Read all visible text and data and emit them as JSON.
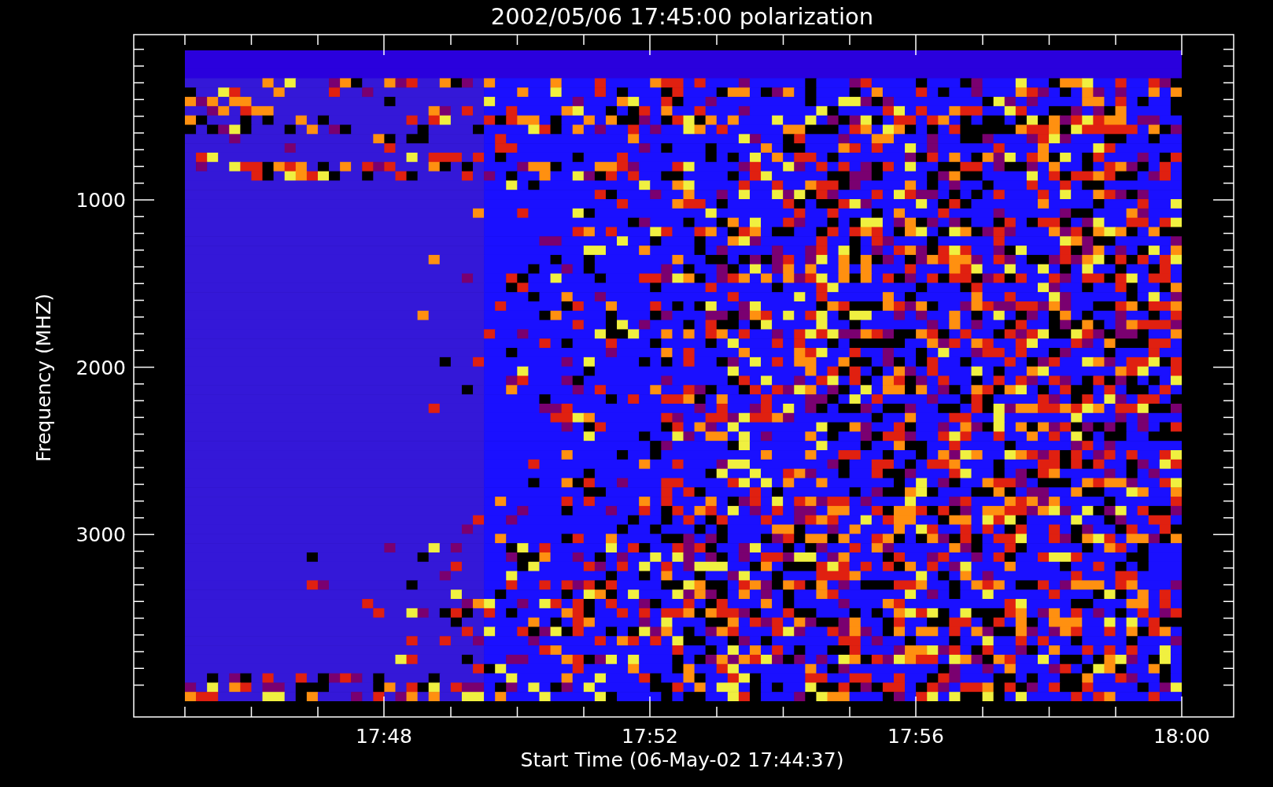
{
  "title": "2002/05/06 17:45:00 polarization",
  "y_axis": {
    "label": "Frequency (MHZ)",
    "ticks": [
      "1000",
      "2000",
      "3000"
    ]
  },
  "x_axis": {
    "label": "Start Time (06-May-02 17:44:37)",
    "ticks": [
      "17:48",
      "17:52",
      "17:56",
      "18:00"
    ]
  }
}
